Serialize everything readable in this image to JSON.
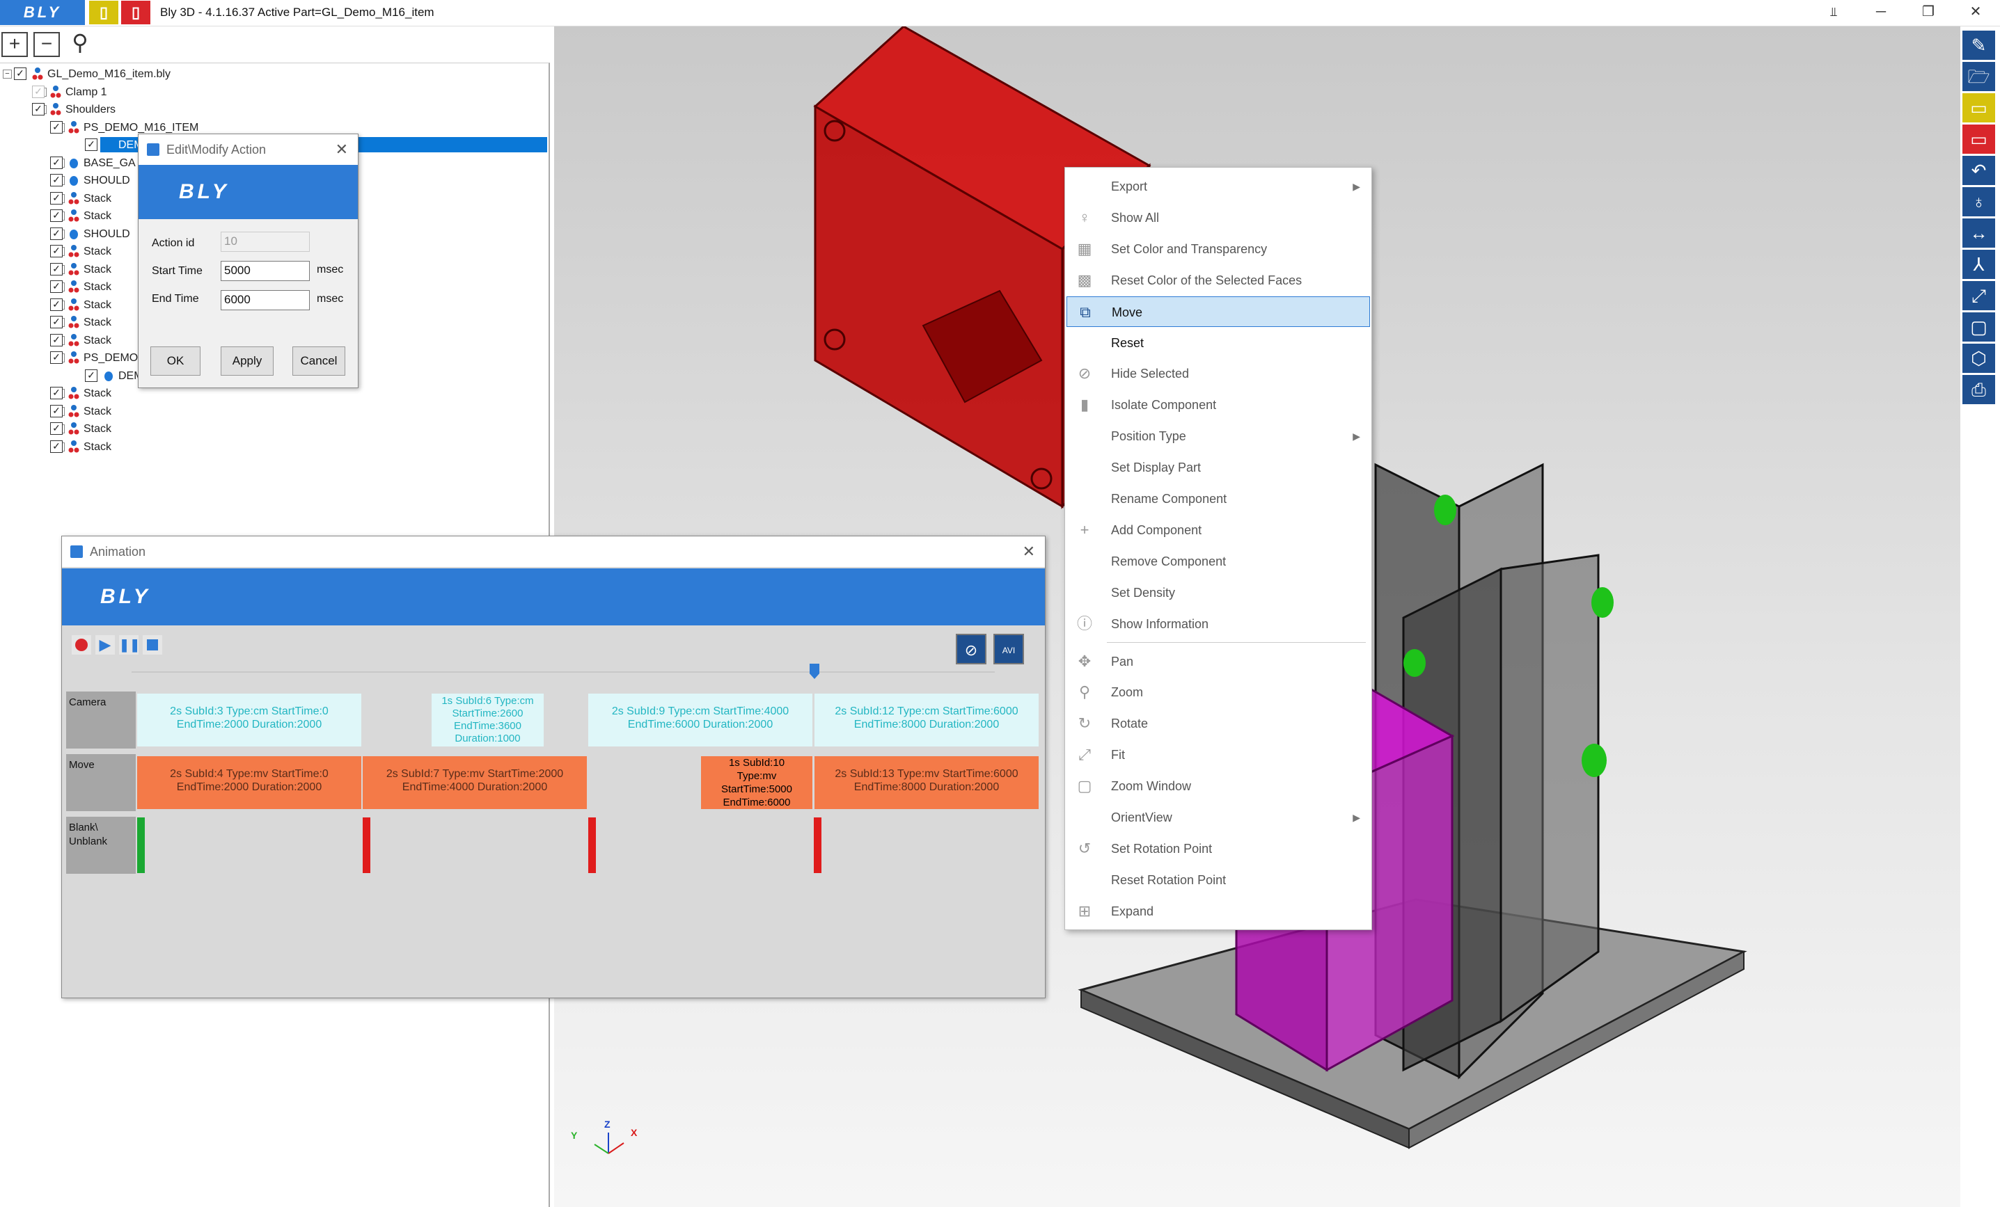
{
  "app": {
    "logo": "BLY",
    "title": "Bly 3D - 4.1.16.37 Active Part=GL_Demo_M16_item",
    "colors": {
      "accent": "#2e7bd5",
      "yellow": "#d6c20d",
      "red": "#d9262b",
      "navy": "#1e4f8f"
    }
  },
  "tree": {
    "items": [
      {
        "label": "GL_Demo_M16_item.bly",
        "indent": 0
      },
      {
        "label": "Clamp 1",
        "indent": 1
      },
      {
        "label": "Shoulders",
        "indent": 1
      },
      {
        "label": "PS_DEMO_M16_ITEM",
        "indent": 2
      },
      {
        "label": "DEMO",
        "indent": 3,
        "selected": true
      },
      {
        "label": "BASE_GA",
        "indent": 2
      },
      {
        "label": "SHOULD",
        "indent": 2
      },
      {
        "label": "Stack",
        "indent": 2
      },
      {
        "label": "Stack",
        "indent": 2
      },
      {
        "label": "SHOULD",
        "indent": 2
      },
      {
        "label": "Stack",
        "indent": 2
      },
      {
        "label": "Stack",
        "indent": 2
      },
      {
        "label": "Stack",
        "indent": 2
      },
      {
        "label": "Stack",
        "indent": 2
      },
      {
        "label": "Stack",
        "indent": 2
      },
      {
        "label": "Stack",
        "indent": 2
      },
      {
        "label": "PS_DEMO",
        "indent": 2
      },
      {
        "label": "DEMO",
        "indent": 3
      },
      {
        "label": "Stack",
        "indent": 2
      },
      {
        "label": "Stack",
        "indent": 2
      },
      {
        "label": "Stack",
        "indent": 2
      },
      {
        "label": "Stack",
        "indent": 2
      }
    ]
  },
  "edit_dialog": {
    "title": "Edit\\Modify Action",
    "logo": "BLY",
    "action_id_label": "Action id",
    "action_id_value": "10",
    "start_label": "Start Time",
    "start_value": "5000",
    "end_label": "End Time",
    "end_value": "6000",
    "unit": "msec",
    "ok": "OK",
    "apply": "Apply",
    "cancel": "Cancel"
  },
  "animation": {
    "title": "Animation",
    "logo": "BLY",
    "rows": {
      "camera": "Camera",
      "move": "Move",
      "blank": "Blank\\\nUnblank"
    },
    "camera_blocks": [
      {
        "l1": "2s SubId:3 Type:cm StartTime:0",
        "l2": "EndTime:2000 Duration:2000"
      },
      {
        "l1": "1s SubId:6 Type:cm",
        "l2": "StartTime:2600",
        "l3": "EndTime:3600",
        "l4": "Duration:1000"
      },
      {
        "l1": "2s SubId:9 Type:cm StartTime:4000",
        "l2": "EndTime:6000 Duration:2000"
      },
      {
        "l1": "2s SubId:12 Type:cm StartTime:6000",
        "l2": "EndTime:8000 Duration:2000"
      }
    ],
    "move_blocks": [
      {
        "l1": "2s SubId:4 Type:mv StartTime:0",
        "l2": "EndTime:2000 Duration:2000"
      },
      {
        "l1": "2s SubId:7 Type:mv StartTime:2000",
        "l2": "EndTime:4000 Duration:2000"
      },
      {
        "l1": "1s SubId:10",
        "l2": "Type:mv",
        "l3": "StartTime:5000",
        "l4": "EndTime:6000"
      },
      {
        "l1": "2s SubId:13 Type:mv StartTime:6000",
        "l2": "EndTime:8000 Duration:2000"
      }
    ]
  },
  "context_menu": {
    "items": [
      {
        "label": "Export",
        "icon": "export-icon",
        "submenu": true
      },
      {
        "label": "Show All",
        "icon": "lightbulb-icon"
      },
      {
        "label": "Set Color and Transparency",
        "icon": "color-grid-icon"
      },
      {
        "label": "Reset Color of the Selected Faces",
        "icon": "reset-color-icon"
      },
      {
        "label": "Move",
        "icon": "move-icon",
        "highlight": true
      },
      {
        "label": "Reset",
        "icon": "",
        "bold": true
      },
      {
        "label": "Hide Selected",
        "icon": "eye-off-icon"
      },
      {
        "label": "Isolate Component",
        "icon": "isolate-icon"
      },
      {
        "label": "Position Type",
        "icon": "",
        "submenu": true
      },
      {
        "label": "Set Display Part",
        "icon": ""
      },
      {
        "label": "Rename Component",
        "icon": ""
      },
      {
        "label": "Add Component",
        "icon": "plus-icon"
      },
      {
        "label": "Remove Component",
        "icon": ""
      },
      {
        "label": "Set Density",
        "icon": ""
      },
      {
        "label": "Show Information",
        "icon": "info-icon"
      },
      {
        "label": "Pan",
        "icon": "pan-icon",
        "sep_before": true
      },
      {
        "label": "Zoom",
        "icon": "zoom-icon"
      },
      {
        "label": "Rotate",
        "icon": "rotate-icon"
      },
      {
        "label": "Fit",
        "icon": "fit-icon"
      },
      {
        "label": "Zoom Window",
        "icon": "zoom-window-icon"
      },
      {
        "label": "OrientView",
        "icon": "",
        "submenu": true
      },
      {
        "label": "Set Rotation Point",
        "icon": "rotation-point-icon"
      },
      {
        "label": "Reset Rotation Point",
        "icon": ""
      },
      {
        "label": "Expand",
        "icon": "expand-icon"
      }
    ]
  },
  "axes": {
    "x": "X",
    "y": "Y",
    "z": "Z"
  }
}
